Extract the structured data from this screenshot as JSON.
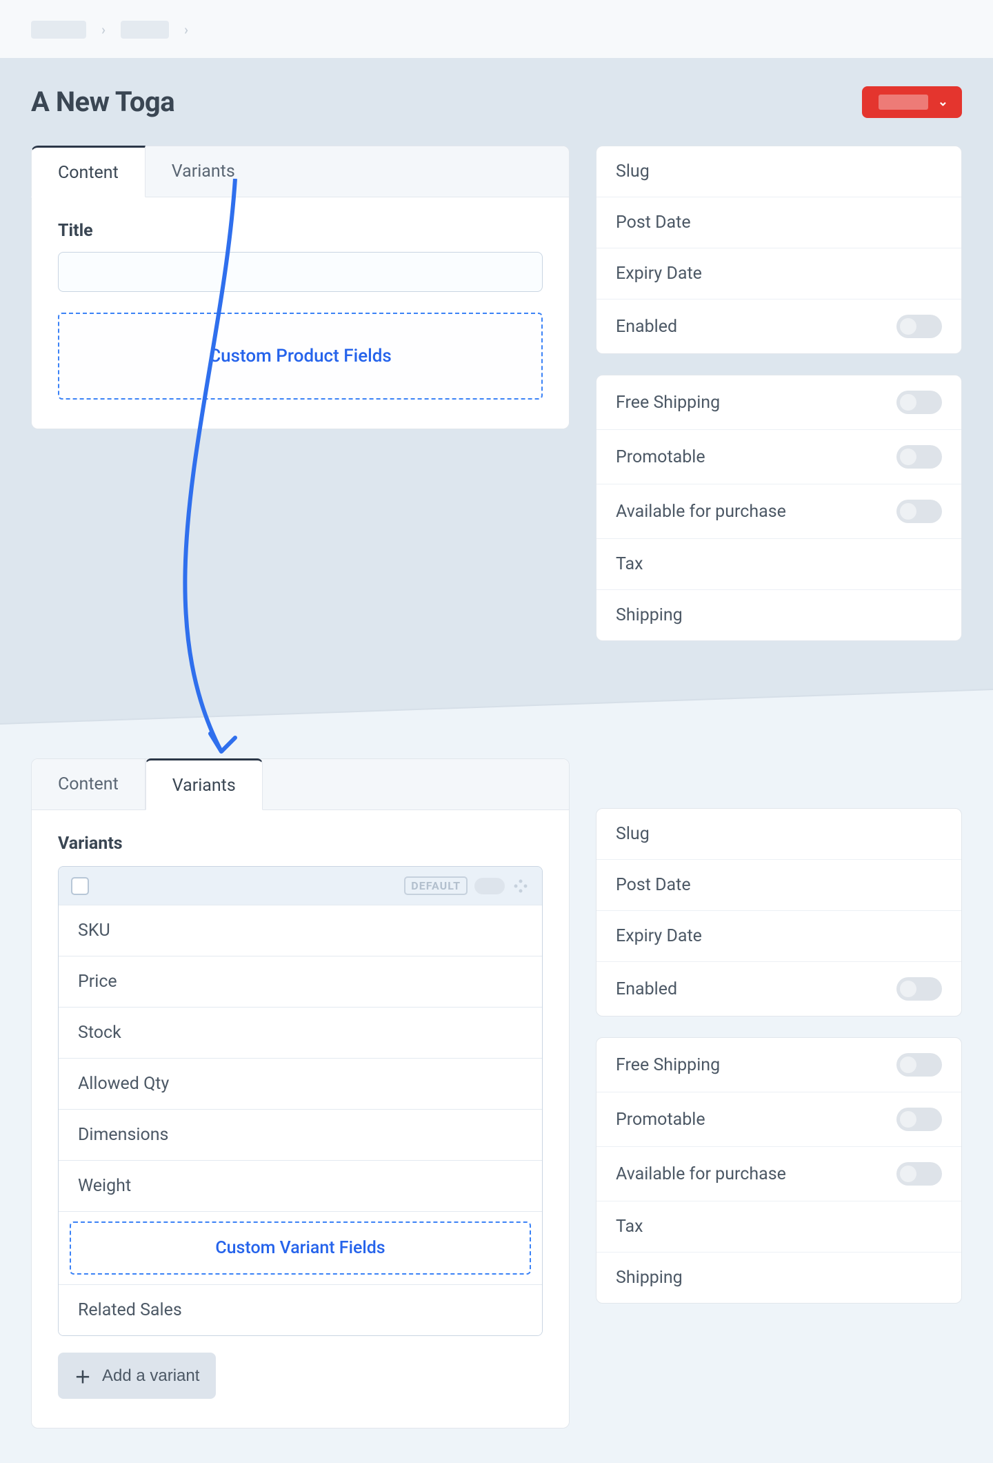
{
  "header": {
    "page_title": "A New Toga"
  },
  "section1": {
    "tabs": {
      "content": "Content",
      "variants": "Variants"
    },
    "title_label": "Title",
    "custom_fields_label": "Custom Product Fields"
  },
  "section2": {
    "tabs": {
      "content": "Content",
      "variants": "Variants"
    },
    "variants_heading": "Variants",
    "default_badge": "DEFAULT",
    "rows": {
      "sku": "SKU",
      "price": "Price",
      "stock": "Stock",
      "allowed_qty": "Allowed Qty",
      "dimensions": "Dimensions",
      "weight": "Weight",
      "related_sales": "Related Sales"
    },
    "custom_variant_label": "Custom Variant Fields",
    "add_variant": "Add a variant"
  },
  "sidebar": {
    "group1": {
      "slug": "Slug",
      "post_date": "Post Date",
      "expiry_date": "Expiry Date",
      "enabled": "Enabled"
    },
    "group2": {
      "free_shipping": "Free Shipping",
      "promotable": "Promotable",
      "available": "Available for purchase",
      "tax": "Tax",
      "shipping": "Shipping"
    }
  }
}
